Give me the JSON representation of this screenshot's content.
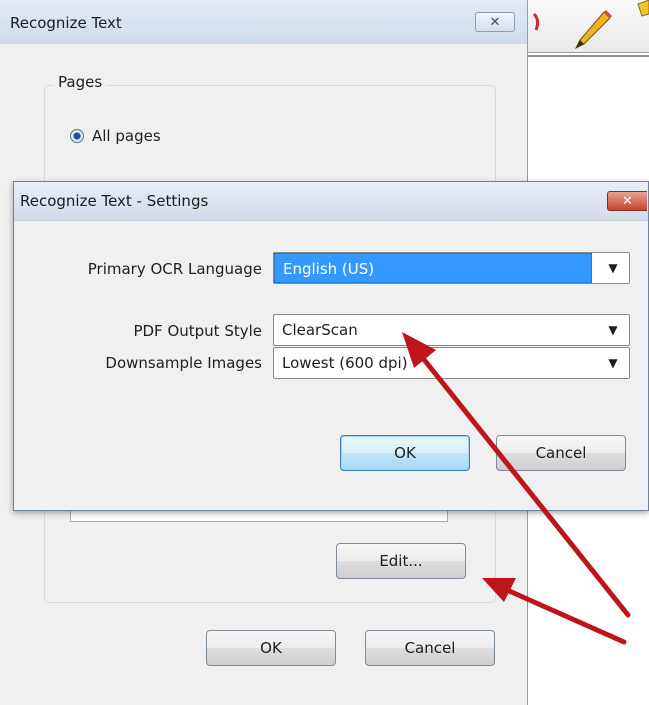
{
  "back_dialog": {
    "title": "Recognize Text",
    "close_icon": "close-icon",
    "pages_group_label": "Pages",
    "all_pages_label": "All pages",
    "edit_button": "Edit...",
    "ok_button": "OK",
    "cancel_button": "Cancel"
  },
  "settings_dialog": {
    "title": "Recognize Text - Settings",
    "close_icon": "close-icon",
    "rows": [
      {
        "label": "Primary OCR Language",
        "value": "English (US)"
      },
      {
        "label": "PDF Output Style",
        "value": "ClearScan"
      },
      {
        "label": "Downsample Images",
        "value": "Lowest (600 dpi)"
      }
    ],
    "ok_button": "OK",
    "cancel_button": "Cancel"
  },
  "annotation_color": "#c0141d",
  "background_app": {
    "icons": [
      "eraser-icon",
      "pencil-icon"
    ]
  }
}
